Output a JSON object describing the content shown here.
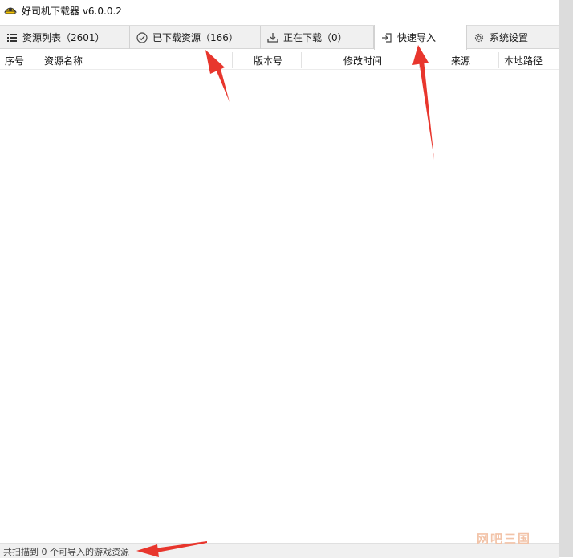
{
  "window": {
    "title": "好司机下载器 v6.0.0.2"
  },
  "tabs": [
    {
      "label": "资源列表（2601）",
      "icon": "list-icon"
    },
    {
      "label": "已下载资源（166）",
      "icon": "check-circle-icon"
    },
    {
      "label": "正在下载（0）",
      "icon": "download-icon"
    },
    {
      "label": "快速导入",
      "icon": "import-icon",
      "active": true
    },
    {
      "label": "系统设置",
      "icon": "gear-icon"
    }
  ],
  "table": {
    "columns": [
      "序号",
      "资源名称",
      "版本号",
      "修改时间",
      "来源",
      "本地路径"
    ],
    "rows": []
  },
  "status": {
    "text": "共扫描到 0 个可导入的游戏资源"
  },
  "watermark": {
    "text": "网吧三国"
  },
  "colors": {
    "accent_arrow": "#e8362d",
    "tabbar_bg": "#f0f0f0"
  }
}
